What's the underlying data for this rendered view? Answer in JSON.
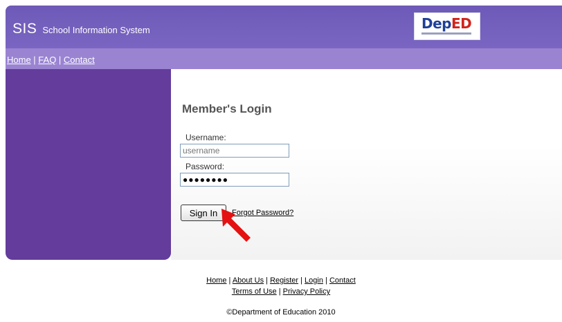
{
  "header": {
    "abbr": "SIS",
    "title": "School Information System",
    "logo_dep": "Dep",
    "logo_ed": "ED"
  },
  "topnav": [
    "Home",
    "FAQ",
    "Contact"
  ],
  "login": {
    "title": "Member's Login",
    "username_label": "Username:",
    "username_placeholder": "username",
    "password_label": "Password:",
    "password_value": "●●●●●●●●",
    "signin_label": "Sign In",
    "forgot_label": "Forgot Password?"
  },
  "footer": {
    "links_row1": [
      "Home",
      "About Us",
      "Register",
      "Login",
      "Contact"
    ],
    "links_row2": [
      "Terms of Use",
      "Privacy Policy"
    ],
    "copyright": "©Department of Education 2010"
  },
  "colors": {
    "header": "#7a66c2",
    "navbar": "#9a84d2",
    "sidebar": "#633c9c",
    "arrow": "#e41212"
  }
}
